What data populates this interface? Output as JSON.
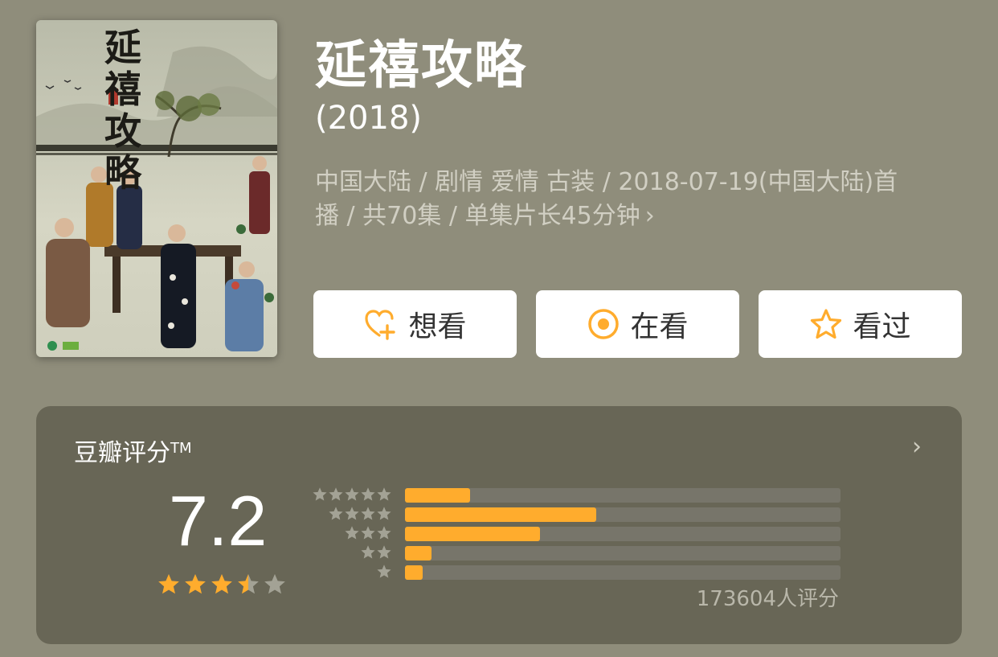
{
  "poster": {
    "calligraphy": "延禧攻略"
  },
  "movie": {
    "title": "延禧攻略",
    "year": "(2018)",
    "meta_line1": "中国大陆 / 剧情 爱情 古装 / 2018-07-19(中国大陆)首",
    "meta_line2": "播 / 共70集 / 单集片长45分钟",
    "meta_chevron": "›"
  },
  "actions": [
    {
      "label": "想看",
      "icon": "heart-plus-icon"
    },
    {
      "label": "在看",
      "icon": "circle-dot-icon"
    },
    {
      "label": "看过",
      "icon": "star-outline-icon"
    }
  ],
  "rating": {
    "panel_title": "豆瓣评分",
    "trademark": "TM",
    "chevron": "›",
    "score": "7.2",
    "score_value": 7.2,
    "stars_value": 3.5,
    "raters": "173604人评分",
    "distribution": [
      {
        "stars": 5,
        "fraction": 0.15
      },
      {
        "stars": 4,
        "fraction": 0.44
      },
      {
        "stars": 3,
        "fraction": 0.31
      },
      {
        "stars": 2,
        "fraction": 0.06
      },
      {
        "stars": 1,
        "fraction": 0.04
      }
    ]
  },
  "colors": {
    "background": "#8f8d7b",
    "panel": "#686656",
    "accent": "#ffac2d",
    "track": "#77756a",
    "meta_text": "#d1cfc3",
    "star_empty": "#a3a295"
  }
}
